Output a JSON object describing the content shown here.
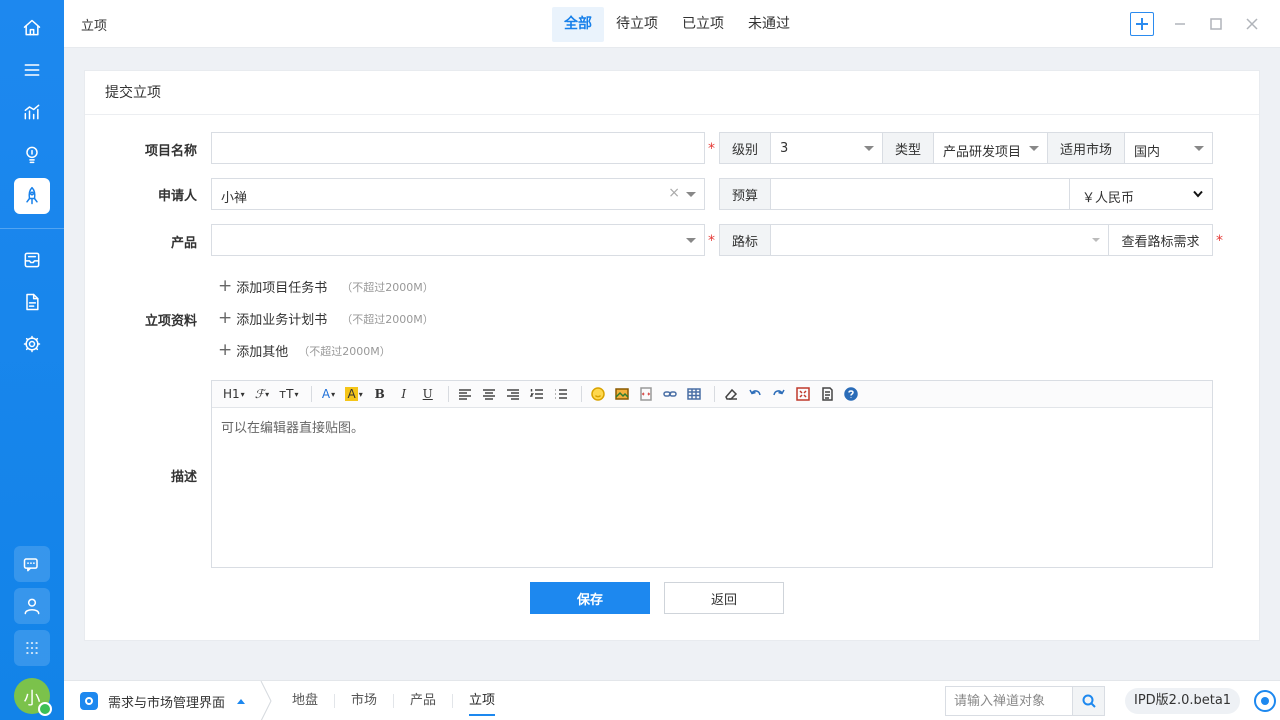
{
  "topbar": {
    "title": "立项",
    "tabs": [
      {
        "label": "全部",
        "active": true
      },
      {
        "label": "待立项"
      },
      {
        "label": "已立项"
      },
      {
        "label": "未通过"
      }
    ]
  },
  "sidebar": {
    "items": [
      "home-icon",
      "menu-icon",
      "chart-icon",
      "bulb-icon",
      "rocket-icon",
      "inbox-icon",
      "doc-icon",
      "gear-icon",
      "chat-icon",
      "user-icon",
      "apps-icon"
    ],
    "avatar": "小"
  },
  "panel": {
    "title": "提交立项"
  },
  "form": {
    "project_name_label": "项目名称",
    "level_label": "级别",
    "level_value": "3",
    "type_label": "类型",
    "type_value": "产品研发项目",
    "market_label": "适用市场",
    "market_value": "国内",
    "applicant_label": "申请人",
    "applicant_value": "小禅",
    "budget_label": "预算",
    "currency_value": "￥人民币",
    "product_label": "产品",
    "roadmap_label": "路标",
    "roadmap_button": "查看路标需求",
    "materials_label": "立项资料",
    "materials": [
      {
        "label": "添加项目任务书",
        "hint": "（不超过2000M）"
      },
      {
        "label": "添加业务计划书",
        "hint": "（不超过2000M）"
      },
      {
        "label": "添加其他",
        "hint": "（不超过2000M）"
      }
    ],
    "description_label": "描述",
    "description_placeholder": "可以在编辑器直接贴图。",
    "save_label": "保存",
    "back_label": "返回"
  },
  "editor": {
    "toolbar": {
      "heading": "H1",
      "font": "ℱ",
      "size": "тT",
      "color": "A",
      "highlight": "A",
      "bold": "B",
      "italic": "I",
      "underline": "U"
    }
  },
  "bottombar": {
    "app_name": "需求与市场管理界面",
    "crumbs": [
      "地盘",
      "市场",
      "产品",
      "立项"
    ],
    "search_placeholder": "请输入禅道对象",
    "version": "IPD版2.0.beta1"
  }
}
